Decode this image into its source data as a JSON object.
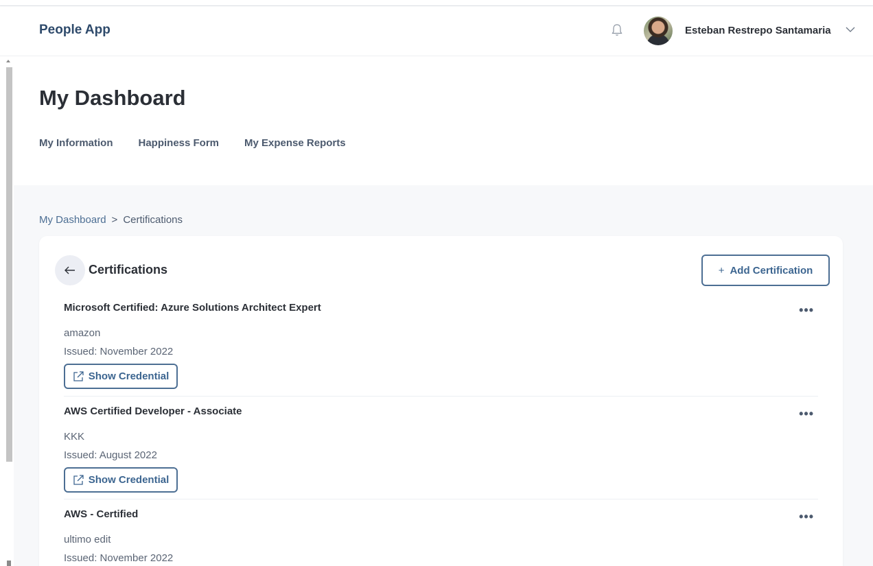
{
  "header": {
    "brand": "People App",
    "user_name": "Esteban Restrepo Santamaria"
  },
  "page": {
    "title": "My Dashboard",
    "subnav": [
      "My Information",
      "Happiness Form",
      "My Expense Reports"
    ]
  },
  "breadcrumb": {
    "root": "My Dashboard",
    "separator": ">",
    "current": "Certifications"
  },
  "certifications_card": {
    "title": "Certifications",
    "add_button_label": "Add Certification",
    "add_button_icon": "+",
    "credential_button_label": "Show Credential",
    "items": [
      {
        "name": "Microsoft Certified: Azure Solutions Architect Expert",
        "issuer": "amazon",
        "issued": "Issued: November 2022",
        "has_credential": true
      },
      {
        "name": "AWS Certified Developer - Associate",
        "issuer": "KKK",
        "issued": "Issued: August 2022",
        "has_credential": true
      },
      {
        "name": "AWS - Certified",
        "issuer": "ultimo edit",
        "issued": "Issued: November 2022",
        "has_credential": false
      }
    ]
  },
  "icons": {
    "notification": "bell-icon",
    "user_menu": "chevron-down-icon",
    "back": "arrow-left-icon",
    "more": "more-horizontal-icon",
    "external_link": "external-link-icon"
  },
  "colors": {
    "brand": "#2e4a6b",
    "accent": "#4c6e93",
    "content_bg": "#f7f8fa"
  }
}
